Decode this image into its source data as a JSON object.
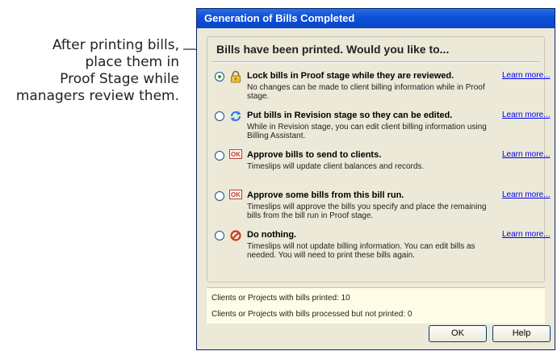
{
  "callout": {
    "lines": [
      "After printing bills,",
      "place them in",
      "Proof Stage while",
      "managers review them."
    ]
  },
  "dialog": {
    "title": "Generation of Bills Completed",
    "heading": "Bills have been printed. Would you like to...",
    "options": [
      {
        "title": "Lock bills in Proof stage while they are reviewed.",
        "desc": "No changes can be made to client billing information while in Proof stage.",
        "link": "Learn more...",
        "icon": "lock-icon",
        "selected": true
      },
      {
        "title": "Put bills in Revision stage so they can be edited.",
        "desc": "While in Revision stage, you can edit client billing information using Billing Assistant.",
        "link": "Learn more...",
        "icon": "refresh-icon",
        "selected": false
      },
      {
        "title": "Approve bills to send to clients.",
        "desc": "Timeslips will update client balances and records.",
        "link": "Learn more...",
        "icon": "ok-badge-icon",
        "selected": false
      },
      {
        "title": "Approve some bills from this bill run.",
        "desc": "Timeslips will approve the bills you specify and place the remaining bills from the bill run in Proof stage.",
        "link": "Learn more...",
        "icon": "ok-badge-icon",
        "selected": false
      },
      {
        "title": "Do nothing.",
        "desc": "Timeslips will not update billing information. You can edit bills as needed. You will need to print these bills again.",
        "link": "Learn more...",
        "icon": "no-entry-icon",
        "selected": false
      }
    ],
    "ok_badge_text": "OK",
    "info": {
      "printed": "Clients or Projects with bills printed: 10",
      "not_printed": "Clients or Projects with bills processed but not printed: 0"
    },
    "buttons": {
      "ok": "OK",
      "help": "Help"
    }
  },
  "colors": {
    "titlebar": "#0b4fd6",
    "dialog_bg": "#ece9d8",
    "link": "#0000ee",
    "radio_dot": "#21a121"
  }
}
